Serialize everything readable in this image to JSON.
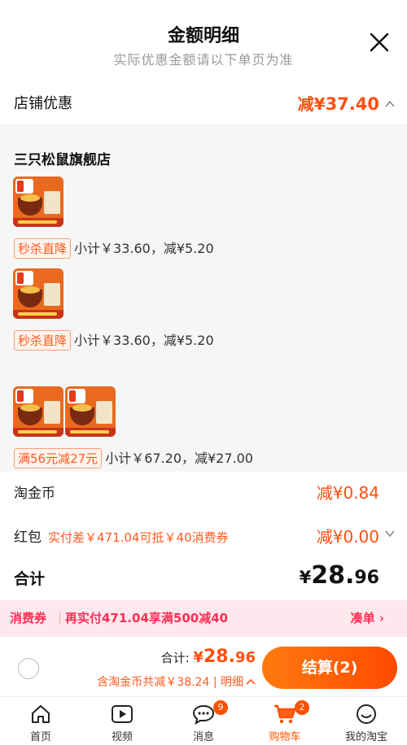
{
  "header": {
    "title": "金额明细",
    "subtitle": "实际优惠金额请以下单页为准"
  },
  "shop_discount": {
    "label": "店铺优惠",
    "prefix": "减¥",
    "amount": "37.40"
  },
  "detail": {
    "store_name": "三只松鼠旗舰店",
    "items": [
      {
        "badge": "秒杀直降",
        "text": "小计￥33.60，减¥5.20"
      },
      {
        "badge": "秒杀直降",
        "text": "小计￥33.60，减¥5.20"
      },
      {
        "badge": "满56元减27元",
        "text": "小计￥67.20，减¥27.00"
      }
    ]
  },
  "taojinbi": {
    "label": "淘金币",
    "value": "减¥0.84"
  },
  "hongbao": {
    "label": "红包",
    "hint": "实付差￥471.04可抵￥40消费券",
    "value": "减¥0.00"
  },
  "total": {
    "label": "合计",
    "currency": "¥",
    "int": "28.",
    "dec": "96"
  },
  "coupon_bar": {
    "tag": "消费券",
    "text": "再实付471.04享满500减40",
    "button": "凑单 ›"
  },
  "checkout": {
    "sum_label": "合计: ",
    "currency": "¥",
    "int": "28.",
    "dec": "96",
    "sub": "含淘金币共减￥38.24 | 明细",
    "pay_button": "结算(2)"
  },
  "tabbar": [
    {
      "label": "首页",
      "icon": "home-icon"
    },
    {
      "label": "视频",
      "icon": "video-icon"
    },
    {
      "label": "消息",
      "icon": "message-icon",
      "badge": "9"
    },
    {
      "label": "购物车",
      "icon": "cart-icon",
      "badge": "2"
    },
    {
      "label": "我的淘宝",
      "icon": "profile-icon"
    }
  ],
  "colors": {
    "accent": "#ff5000",
    "discount": "#ff4f0f",
    "coupon": "#ff2d55"
  }
}
